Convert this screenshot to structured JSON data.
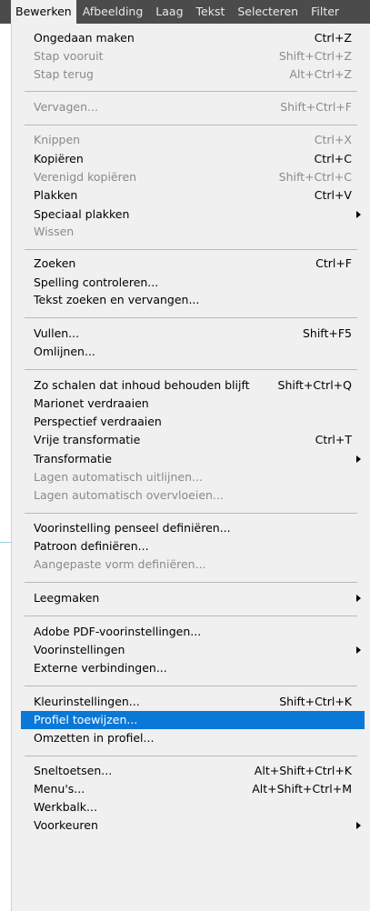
{
  "menubar": {
    "items": [
      {
        "label": "Bewerken",
        "active": true
      },
      {
        "label": "Afbeelding",
        "active": false
      },
      {
        "label": "Laag",
        "active": false
      },
      {
        "label": "Tekst",
        "active": false
      },
      {
        "label": "Selecteren",
        "active": false
      },
      {
        "label": "Filter",
        "active": false
      }
    ]
  },
  "menu": {
    "items": [
      {
        "label": "Ongedaan maken",
        "shortcut": "Ctrl+Z",
        "state": "enabled"
      },
      {
        "label": "Stap vooruit",
        "shortcut": "Shift+Ctrl+Z",
        "state": "disabled"
      },
      {
        "label": "Stap terug",
        "shortcut": "Alt+Ctrl+Z",
        "state": "disabled"
      },
      {
        "label": "Vervagen...",
        "shortcut": "Shift+Ctrl+F",
        "state": "disabled"
      },
      {
        "label": "Knippen",
        "shortcut": "Ctrl+X",
        "state": "disabled"
      },
      {
        "label": "Kopiëren",
        "shortcut": "Ctrl+C",
        "state": "enabled"
      },
      {
        "label": "Verenigd kopiëren",
        "shortcut": "Shift+Ctrl+C",
        "state": "disabled"
      },
      {
        "label": "Plakken",
        "shortcut": "Ctrl+V",
        "state": "enabled"
      },
      {
        "label": "Speciaal plakken",
        "shortcut": "",
        "state": "enabled",
        "submenu": true
      },
      {
        "label": "Wissen",
        "shortcut": "",
        "state": "disabled"
      },
      {
        "label": "Zoeken",
        "shortcut": "Ctrl+F",
        "state": "enabled"
      },
      {
        "label": "Spelling controleren...",
        "shortcut": "",
        "state": "enabled"
      },
      {
        "label": "Tekst zoeken en vervangen...",
        "shortcut": "",
        "state": "enabled"
      },
      {
        "label": "Vullen...",
        "shortcut": "Shift+F5",
        "state": "enabled"
      },
      {
        "label": "Omlijnen...",
        "shortcut": "",
        "state": "enabled"
      },
      {
        "label": "Zo schalen dat inhoud behouden blijft",
        "shortcut": "Shift+Ctrl+Q",
        "state": "enabled"
      },
      {
        "label": "Marionet verdraaien",
        "shortcut": "",
        "state": "enabled"
      },
      {
        "label": "Perspectief verdraaien",
        "shortcut": "",
        "state": "enabled"
      },
      {
        "label": "Vrije transformatie",
        "shortcut": "Ctrl+T",
        "state": "enabled"
      },
      {
        "label": "Transformatie",
        "shortcut": "",
        "state": "enabled",
        "submenu": true
      },
      {
        "label": "Lagen automatisch uitlijnen...",
        "shortcut": "",
        "state": "disabled"
      },
      {
        "label": "Lagen automatisch overvloeien...",
        "shortcut": "",
        "state": "disabled"
      },
      {
        "label": "Voorinstelling penseel definiëren...",
        "shortcut": "",
        "state": "enabled"
      },
      {
        "label": "Patroon definiëren...",
        "shortcut": "",
        "state": "enabled"
      },
      {
        "label": "Aangepaste vorm definiëren...",
        "shortcut": "",
        "state": "disabled"
      },
      {
        "label": "Leegmaken",
        "shortcut": "",
        "state": "enabled",
        "submenu": true
      },
      {
        "label": "Adobe PDF-voorinstellingen...",
        "shortcut": "",
        "state": "enabled"
      },
      {
        "label": "Voorinstellingen",
        "shortcut": "",
        "state": "enabled",
        "submenu": true
      },
      {
        "label": "Externe verbindingen...",
        "shortcut": "",
        "state": "enabled"
      },
      {
        "label": "Kleurinstellingen...",
        "shortcut": "Shift+Ctrl+K",
        "state": "enabled"
      },
      {
        "label": "Profiel toewijzen...",
        "shortcut": "",
        "state": "highlighted"
      },
      {
        "label": "Omzetten in profiel...",
        "shortcut": "",
        "state": "enabled"
      },
      {
        "label": "Sneltoetsen...",
        "shortcut": "Alt+Shift+Ctrl+K",
        "state": "enabled"
      },
      {
        "label": "Menu's...",
        "shortcut": "Alt+Shift+Ctrl+M",
        "state": "enabled"
      },
      {
        "label": "Werkbalk...",
        "shortcut": "",
        "state": "enabled"
      },
      {
        "label": "Voorkeuren",
        "shortcut": "",
        "state": "enabled",
        "submenu": true
      }
    ]
  }
}
